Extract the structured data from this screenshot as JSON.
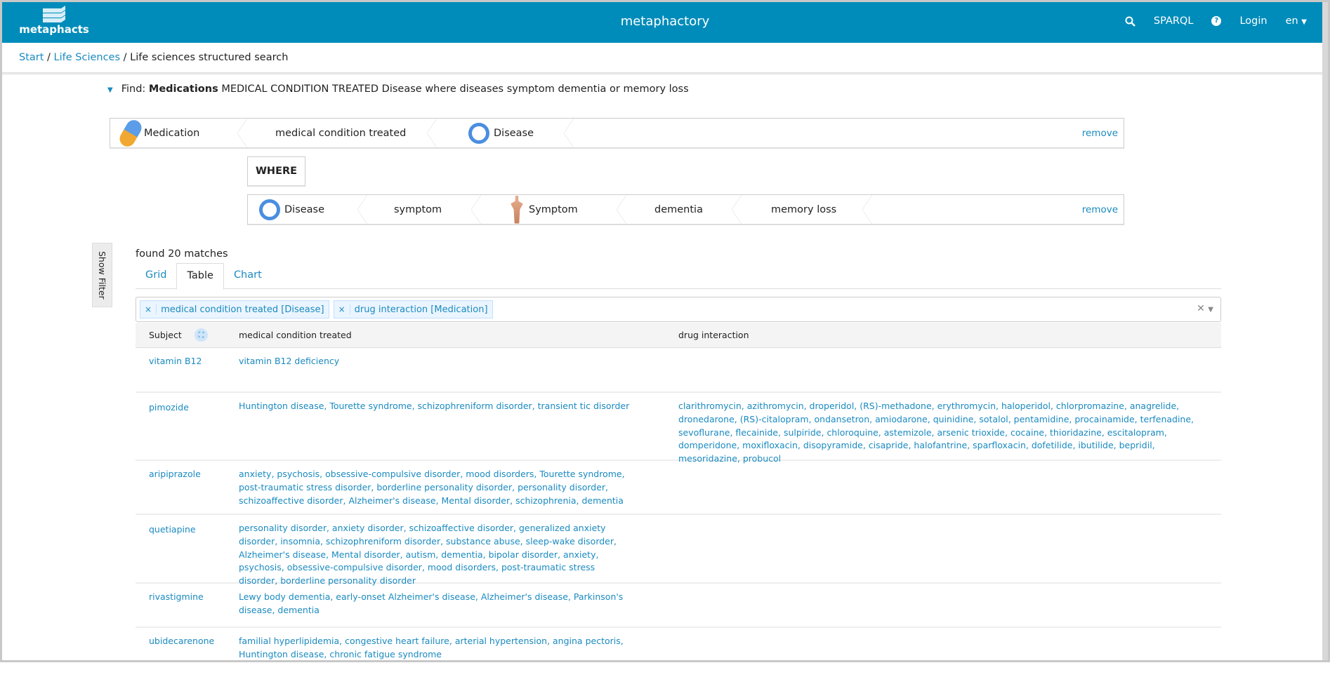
{
  "navbar": {
    "logo_text": "metaphacts",
    "title": "metaphactory",
    "sparql": "SPARQL",
    "login": "Login",
    "lang": "en"
  },
  "breadcrumb": {
    "start": "Start",
    "life_sciences": "Life Sciences",
    "current": "Life sciences structured search"
  },
  "find": {
    "prefix": "Find:",
    "entity": "Medications",
    "rest": "MEDICAL CONDITION TREATED Disease where diseases symptom dementia or memory loss"
  },
  "query_row1": {
    "chips": [
      "Medication",
      "medical condition treated",
      "Disease"
    ],
    "remove": "remove"
  },
  "where_label": "WHERE",
  "query_row2": {
    "chips": [
      "Disease",
      "symptom",
      "Symptom",
      "dementia",
      "memory loss"
    ],
    "remove": "remove"
  },
  "show_filter": "Show Filter",
  "found": "found 20 matches",
  "tabs": [
    "Grid",
    "Table",
    "Chart"
  ],
  "active_tab": "Table",
  "column_tags": [
    "medical condition treated [Disease]",
    "drug interaction [Medication]"
  ],
  "table": {
    "headers": [
      "Subject",
      "medical condition treated",
      "drug interaction"
    ],
    "rows": [
      {
        "subject": "vitamin B12",
        "conditions": "vitamin B12 deficiency",
        "interactions": ""
      },
      {
        "subject": "pimozide",
        "conditions": "Huntington disease, Tourette syndrome, schizophreniform disorder, transient tic disorder",
        "interactions": "clarithromycin, azithromycin, droperidol, (RS)-methadone, erythromycin, haloperidol, chlorpromazine, anagrelide, dronedarone, (RS)-citalopram, ondansetron, amiodarone, quinidine, sotalol, pentamidine, procainamide, terfenadine, sevoflurane, flecainide, sulpiride, chloroquine, astemizole, arsenic trioxide, cocaine, thioridazine, escitalopram, domperidone, moxifloxacin, disopyramide, cisapride, halofantrine, sparfloxacin, dofetilide, ibutilide, bepridil, mesoridazine, probucol"
      },
      {
        "subject": "aripiprazole",
        "conditions": "anxiety, psychosis, obsessive-compulsive disorder, mood disorders, Tourette syndrome, post-traumatic stress disorder, borderline personality disorder, personality disorder, schizoaffective disorder, Alzheimer's disease, Mental disorder, schizophrenia, dementia",
        "interactions": ""
      },
      {
        "subject": "quetiapine",
        "conditions": "personality disorder, anxiety disorder, schizoaffective disorder, generalized anxiety disorder, insomnia, schizophreniform disorder, substance abuse, sleep-wake disorder, Alzheimer's disease, Mental disorder, autism, dementia, bipolar disorder, anxiety, psychosis, obsessive-compulsive disorder, mood disorders, post-traumatic stress disorder, borderline personality disorder",
        "interactions": ""
      },
      {
        "subject": "rivastigmine",
        "conditions": "Lewy body dementia, early-onset Alzheimer's disease, Alzheimer's disease, Parkinson's disease, dementia",
        "interactions": ""
      },
      {
        "subject": "ubidecarenone",
        "conditions": "familial hyperlipidemia, congestive heart failure, arterial hypertension, angina pectoris, Huntington disease, chronic fatigue syndrome",
        "interactions": ""
      }
    ]
  }
}
